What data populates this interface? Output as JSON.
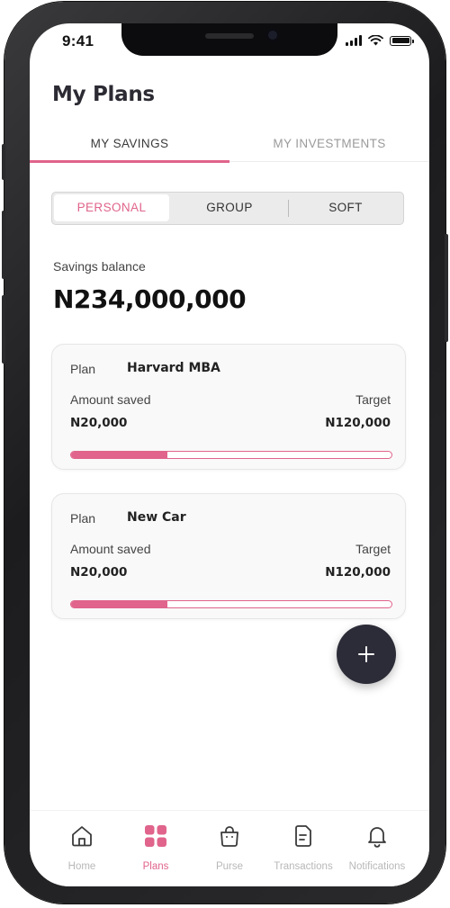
{
  "status_bar": {
    "time": "9:41"
  },
  "header": {
    "title": "My Plans"
  },
  "tabs": [
    {
      "label": "MY SAVINGS",
      "active": true
    },
    {
      "label": "MY INVESTMENTS",
      "active": false
    }
  ],
  "segments": [
    {
      "label": "PERSONAL",
      "active": true
    },
    {
      "label": "GROUP",
      "active": false
    },
    {
      "label": "SOFT",
      "active": false
    }
  ],
  "balance": {
    "label": "Savings balance",
    "value": "N234,000,000"
  },
  "plans": [
    {
      "plan_label": "Plan",
      "name": "Harvard MBA",
      "amount_label": "Amount saved",
      "amount": "N20,000",
      "target_label": "Target",
      "target": "N120,000",
      "progress_fraction": 0.3
    },
    {
      "plan_label": "Plan",
      "name": "New Car",
      "amount_label": "Amount saved",
      "amount": "N20,000",
      "target_label": "Target",
      "target": "N120,000",
      "progress_fraction": 0.3
    }
  ],
  "fab": {
    "icon": "plus-icon"
  },
  "nav": [
    {
      "label": "Home",
      "icon": "home-icon",
      "active": false
    },
    {
      "label": "Plans",
      "icon": "grid-icon",
      "active": true
    },
    {
      "label": "Purse",
      "icon": "bag-icon",
      "active": false
    },
    {
      "label": "Transactions",
      "icon": "document-icon",
      "active": false
    },
    {
      "label": "Notifications",
      "icon": "bell-icon",
      "active": false
    }
  ],
  "colors": {
    "accent": "#e0648b",
    "fab": "#2c2c38",
    "text_dark": "#2c2a33",
    "inactive": "#b8b8b8"
  }
}
